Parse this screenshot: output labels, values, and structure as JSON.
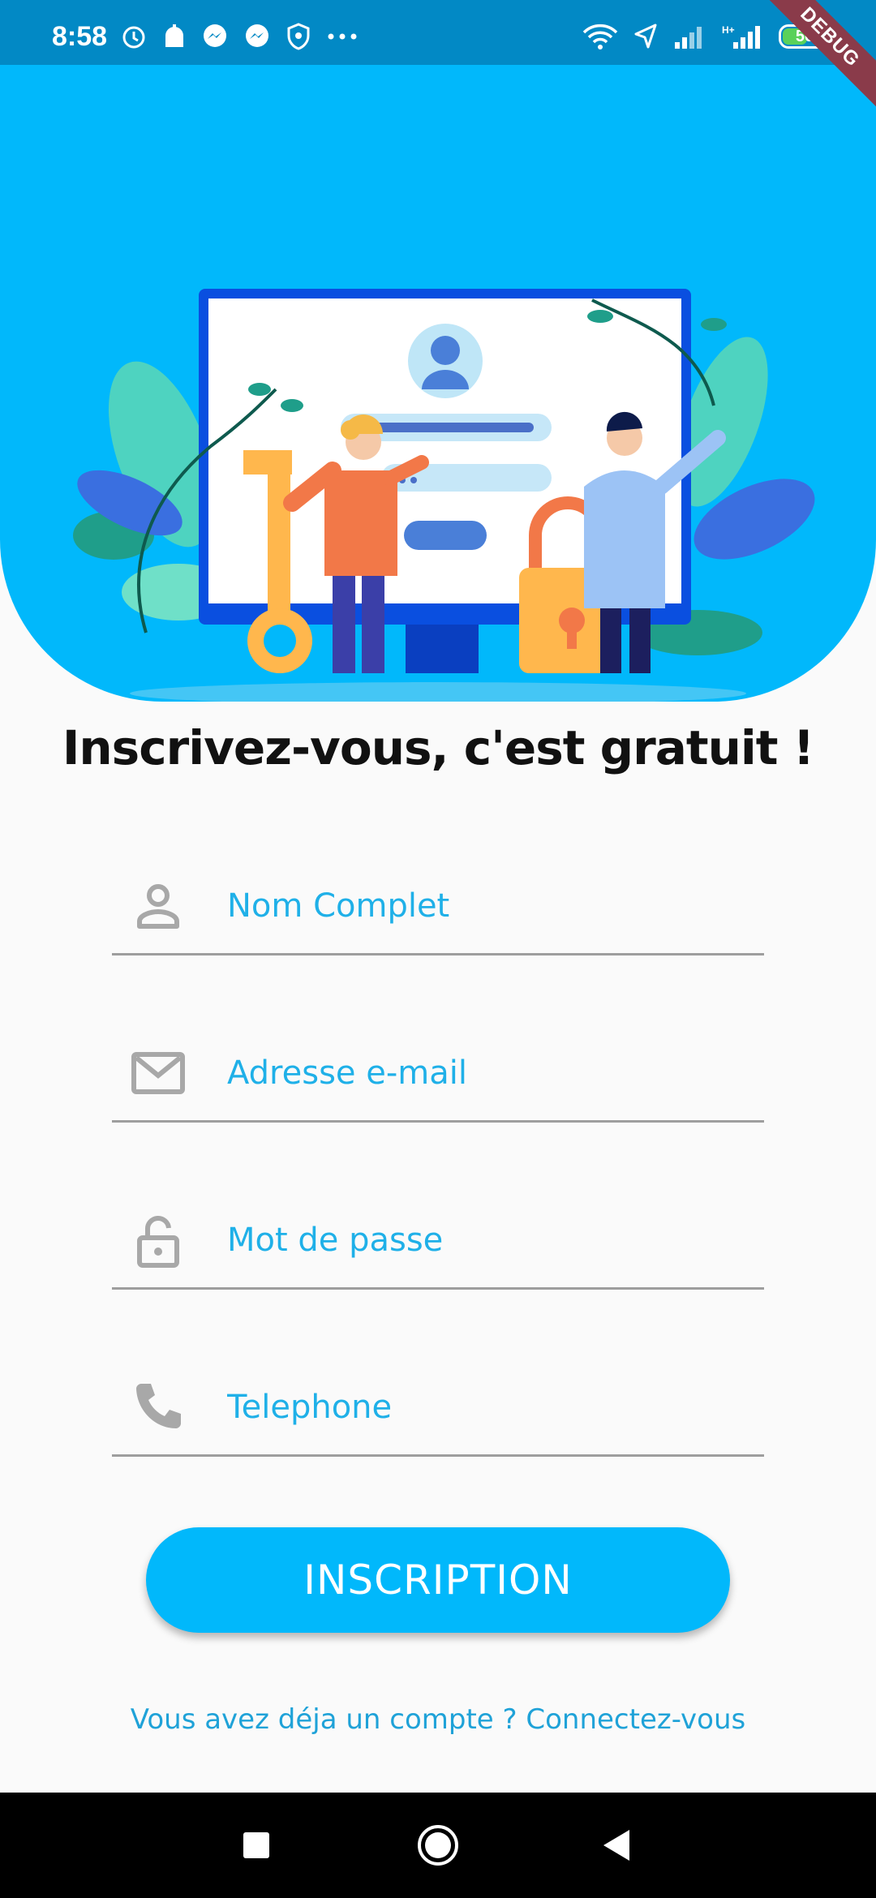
{
  "status": {
    "time": "8:58",
    "battery": "56"
  },
  "debug_label": "DEBUG",
  "title": "Inscrivez-vous, c'est gratuit !",
  "fields": [
    {
      "placeholder": "Nom Complet",
      "icon": "person-icon"
    },
    {
      "placeholder": "Adresse e-mail",
      "icon": "mail-icon"
    },
    {
      "placeholder": "Mot de passe",
      "icon": "lock-icon"
    },
    {
      "placeholder": "Telephone",
      "icon": "phone-icon"
    }
  ],
  "submit_label": "INSCRIPTION",
  "login_text": "Vous avez déja un compte ? Connectez-vous",
  "colors": {
    "primary": "#01b8fb",
    "status_bar": "#0289c5",
    "accent_text": "#1fb0e8"
  }
}
